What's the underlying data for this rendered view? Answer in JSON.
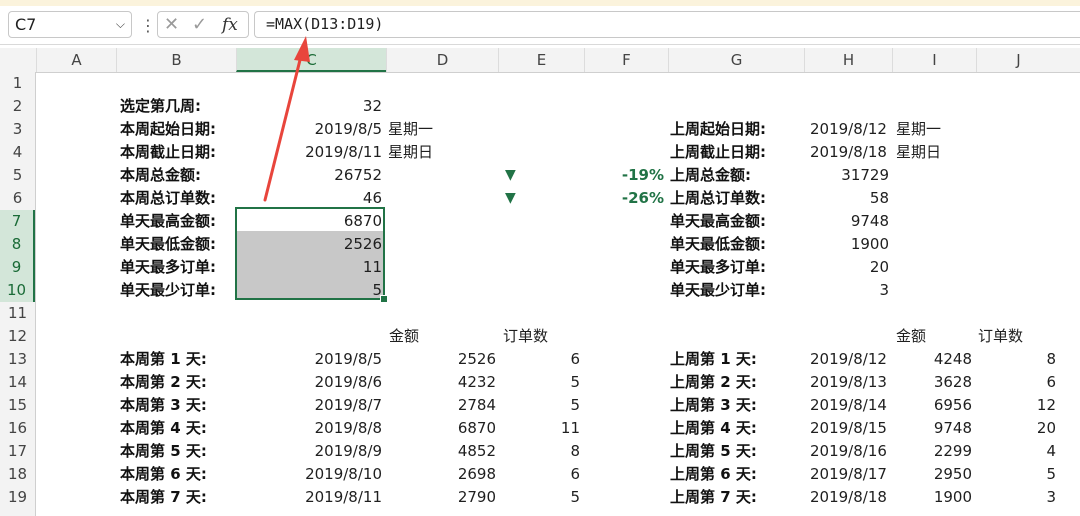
{
  "toolbar": {
    "name_box": "C7",
    "formula": "=MAX(D13:D19)",
    "fx_label": "fx"
  },
  "columns": [
    "A",
    "B",
    "C",
    "D",
    "E",
    "F",
    "G",
    "H",
    "I",
    "J"
  ],
  "rows": [
    "1",
    "2",
    "3",
    "4",
    "5",
    "6",
    "7",
    "8",
    "9",
    "10",
    "11",
    "12",
    "13",
    "14",
    "15",
    "16",
    "17",
    "18",
    "19"
  ],
  "left": {
    "week_select_label": "选定第几周:",
    "week_select_value": "32",
    "start_label": "本周起始日期:",
    "start_date": "2019/8/5",
    "start_weekday": "星期一",
    "end_label": "本周截止日期:",
    "end_date": "2019/8/11",
    "end_weekday": "星期日",
    "total_amount_label": "本周总金额:",
    "total_amount": "26752",
    "total_orders_label": "本周总订单数:",
    "total_orders": "46",
    "max_amount_label": "单天最高金额:",
    "max_amount": "6870",
    "min_amount_label": "单天最低金额:",
    "min_amount": "2526",
    "max_orders_label": "单天最多订单:",
    "max_orders": "11",
    "min_orders_label": "单天最少订单:",
    "min_orders": "5"
  },
  "compare": {
    "amount_change": "-19%",
    "orders_change": "-26%",
    "arrow_glyph": "▼",
    "color": "#217346"
  },
  "right": {
    "start_label": "上周起始日期:",
    "start_date": "2019/8/12",
    "start_weekday": "星期一",
    "end_label": "上周截止日期:",
    "end_date": "2019/8/18",
    "end_weekday": "星期日",
    "total_amount_label": "上周总金额:",
    "total_amount": "31729",
    "total_orders_label": "上周总订单数:",
    "total_orders": "58",
    "max_amount_label": "单天最高金额:",
    "max_amount": "9748",
    "min_amount_label": "单天最低金额:",
    "min_amount": "1900",
    "max_orders_label": "单天最多订单:",
    "max_orders": "20",
    "min_orders_label": "单天最少订单:",
    "min_orders": "3"
  },
  "table_headers": {
    "amount": "金额",
    "orders": "订单数"
  },
  "this_week": [
    {
      "label": "本周第 1 天:",
      "date": "2019/8/5",
      "amount": "2526",
      "orders": "6"
    },
    {
      "label": "本周第 2 天:",
      "date": "2019/8/6",
      "amount": "4232",
      "orders": "5"
    },
    {
      "label": "本周第 3 天:",
      "date": "2019/8/7",
      "amount": "2784",
      "orders": "5"
    },
    {
      "label": "本周第 4 天:",
      "date": "2019/8/8",
      "amount": "6870",
      "orders": "11"
    },
    {
      "label": "本周第 5 天:",
      "date": "2019/8/9",
      "amount": "4852",
      "orders": "8"
    },
    {
      "label": "本周第 6 天:",
      "date": "2019/8/10",
      "amount": "2698",
      "orders": "6"
    },
    {
      "label": "本周第 7 天:",
      "date": "2019/8/11",
      "amount": "2790",
      "orders": "5"
    }
  ],
  "last_week": [
    {
      "label": "上周第 1 天:",
      "date": "2019/8/12",
      "amount": "4248",
      "orders": "8"
    },
    {
      "label": "上周第 2 天:",
      "date": "2019/8/13",
      "amount": "3628",
      "orders": "6"
    },
    {
      "label": "上周第 3 天:",
      "date": "2019/8/14",
      "amount": "6956",
      "orders": "12"
    },
    {
      "label": "上周第 4 天:",
      "date": "2019/8/15",
      "amount": "9748",
      "orders": "20"
    },
    {
      "label": "上周第 5 天:",
      "date": "2019/8/16",
      "amount": "2299",
      "orders": "4"
    },
    {
      "label": "上周第 6 天:",
      "date": "2019/8/17",
      "amount": "2950",
      "orders": "5"
    },
    {
      "label": "上周第 7 天:",
      "date": "2019/8/18",
      "amount": "1900",
      "orders": "3"
    }
  ],
  "annotation_color": "#e8453c"
}
